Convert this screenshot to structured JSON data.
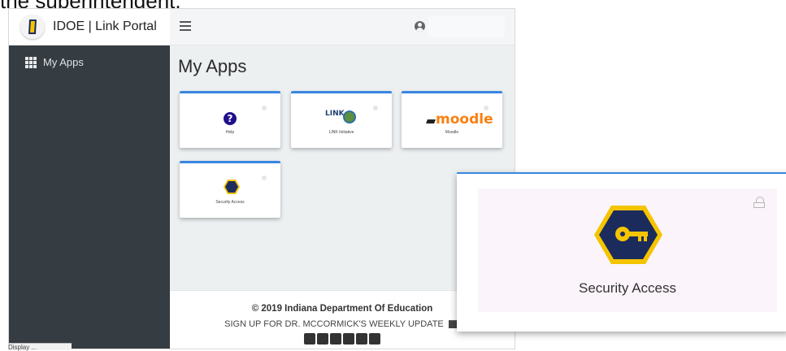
{
  "caption": "the superintendent.",
  "brand": {
    "title": "IDOE | Link Portal"
  },
  "sidebar": {
    "items": [
      {
        "label": "My Apps",
        "icon": "grid-icon"
      }
    ]
  },
  "topbar": {
    "menu_icon": "hamburger-icon",
    "user_icon": "user-circle-icon"
  },
  "main": {
    "title": "My Apps",
    "apps": [
      {
        "label": "Help",
        "icon": "help-icon"
      },
      {
        "label": "LINK Initiative",
        "icon": "link-initiative-logo"
      },
      {
        "label": "Moodle",
        "icon": "moodle-logo"
      },
      {
        "label": "Security Access",
        "icon": "key-icon"
      }
    ]
  },
  "footer": {
    "copyright": "© 2019 Indiana Department Of Education",
    "signup": "SIGN UP FOR DR. MCCORMICK'S WEEKLY UPDATE",
    "social_icons": [
      "facebook-icon",
      "instagram-icon",
      "twitter-icon",
      "youtube-icon",
      "rss-icon",
      "flickr-icon"
    ]
  },
  "zoom": {
    "label": "Security Access",
    "lock_icon": "lock-icon"
  },
  "tooltip": {
    "text": "Display ..."
  },
  "colors": {
    "accent": "#3a86e0",
    "sidebar": "#353c42",
    "moodle": "#f98012",
    "key_gold": "#f5c400",
    "key_navy": "#1b2b5c"
  }
}
